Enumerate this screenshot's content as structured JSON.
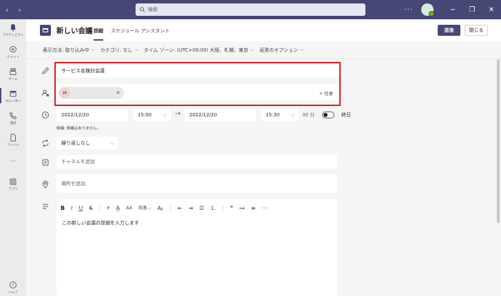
{
  "titlebar": {
    "back": "‹",
    "forward": "›",
    "search_placeholder": "検索",
    "more": "···",
    "minimize": "−",
    "maximize": "❐",
    "close": "✕"
  },
  "rail": [
    {
      "id": "activity",
      "label": "アクティビティ",
      "icon": "bell-icon"
    },
    {
      "id": "chat",
      "label": "チャット",
      "icon": "chat-icon"
    },
    {
      "id": "teams",
      "label": "チーム",
      "icon": "teams-icon"
    },
    {
      "id": "calendar",
      "label": "カレンダー",
      "icon": "calendar-icon",
      "active": true
    },
    {
      "id": "calls",
      "label": "通話",
      "icon": "phone-icon"
    },
    {
      "id": "files",
      "label": "ファイル",
      "icon": "file-icon"
    },
    {
      "id": "more",
      "label": "···",
      "icon": "more-icon"
    },
    {
      "id": "apps",
      "label": "アプリ",
      "icon": "apps-icon"
    },
    {
      "id": "help",
      "label": "ヘルプ",
      "icon": "help-icon"
    }
  ],
  "header": {
    "title": "新しい会議",
    "tab_details": "詳細",
    "tab_schedule": "スケジュール アシスタント",
    "send": "送信",
    "close": "閉じる"
  },
  "options": {
    "show_as": "表示方法: 取り込み中",
    "category": "カテゴリ: なし",
    "timezone": "タイム ゾーン: (UTC+09:00) 大阪、札幌、東京",
    "response": "返答のオプション"
  },
  "form": {
    "title_value": "サービス名検討会議",
    "attendee_initial": "M",
    "attendee_remove": "×",
    "optional_label": "+ 任意",
    "start_date": "2022/12/20",
    "start_time": "15:00",
    "arrow": "→",
    "end_date": "2022/12/20",
    "end_time": "15:30",
    "duration": "30 分",
    "all_day": "終日",
    "suggestion": "候補: 候補はありません。",
    "repeat": "繰り返しなし",
    "channel_placeholder": "チャネルを追加",
    "location_placeholder": "場所を追加",
    "body_placeholder": "この新しい会議の詳細を入力します"
  },
  "editor_toolbar": {
    "bold": "B",
    "italic": "I",
    "underline": "U",
    "strike": "S",
    "paragraph": "段落"
  }
}
